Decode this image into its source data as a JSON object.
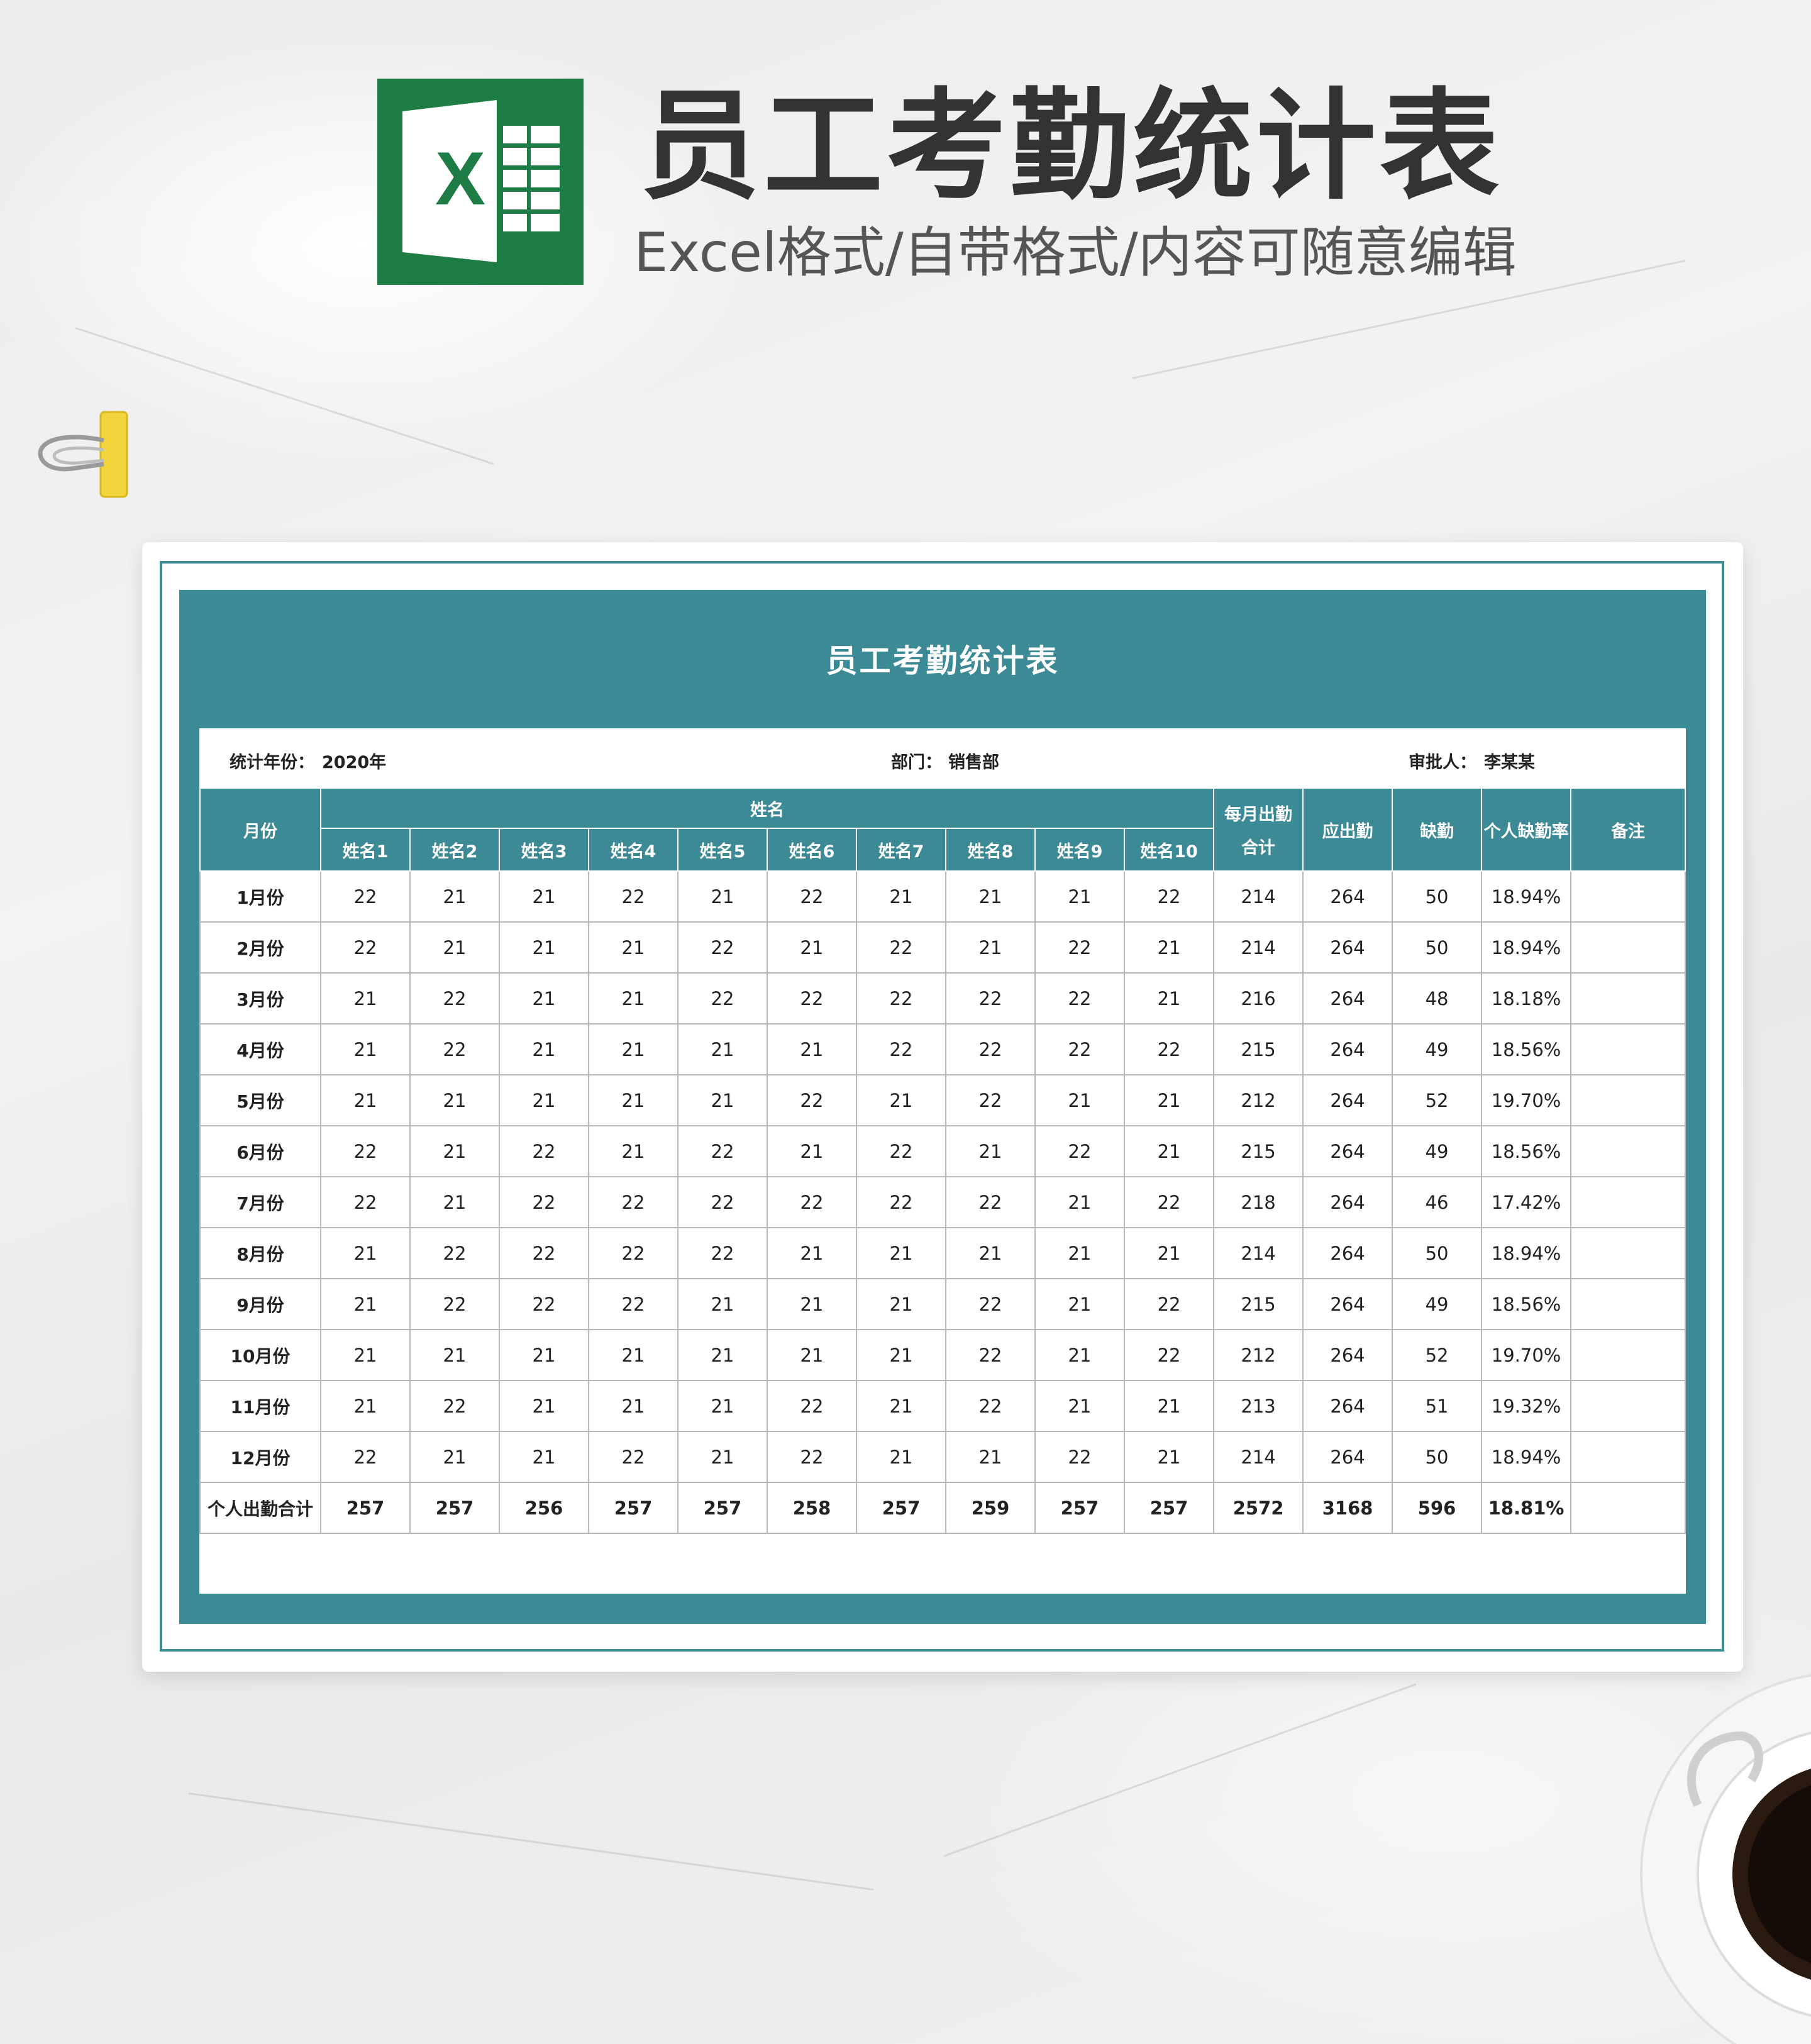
{
  "header": {
    "title": "员工考勤统计表",
    "subtitle": "Excel格式/自带格式/内容可随意编辑",
    "logo_letter": "X"
  },
  "colors": {
    "accent": "#3b8a96",
    "excel_green": "#1d7d45",
    "clip_yellow": "#f2d53c"
  },
  "sheet": {
    "title": "员工考勤统计表",
    "meta": {
      "year_label": "统计年份：",
      "year_value": "2020年",
      "dept_label": "部门：",
      "dept_value": "销售部",
      "approver_label": "审批人：",
      "approver_value": "李某某"
    },
    "headers": {
      "month": "月份",
      "name_group": "姓名",
      "names": [
        "姓名1",
        "姓名2",
        "姓名3",
        "姓名4",
        "姓名5",
        "姓名6",
        "姓名7",
        "姓名8",
        "姓名9",
        "姓名10"
      ],
      "monthly_total_line1": "每月出勤",
      "monthly_total_line2": "合计",
      "expected": "应出勤",
      "absent": "缺勤",
      "absence_rate": "个人缺勤率",
      "remark": "备注"
    },
    "rows": [
      {
        "month": "1月份",
        "v": [
          "22",
          "21",
          "21",
          "22",
          "21",
          "22",
          "21",
          "21",
          "21",
          "22"
        ],
        "total": "214",
        "expected": "264",
        "absent": "50",
        "rate": "18.94%",
        "remark": ""
      },
      {
        "month": "2月份",
        "v": [
          "22",
          "21",
          "21",
          "21",
          "22",
          "21",
          "22",
          "21",
          "22",
          "21"
        ],
        "total": "214",
        "expected": "264",
        "absent": "50",
        "rate": "18.94%",
        "remark": ""
      },
      {
        "month": "3月份",
        "v": [
          "21",
          "22",
          "21",
          "21",
          "22",
          "22",
          "22",
          "22",
          "22",
          "21"
        ],
        "total": "216",
        "expected": "264",
        "absent": "48",
        "rate": "18.18%",
        "remark": ""
      },
      {
        "month": "4月份",
        "v": [
          "21",
          "22",
          "21",
          "21",
          "21",
          "21",
          "22",
          "22",
          "22",
          "22"
        ],
        "total": "215",
        "expected": "264",
        "absent": "49",
        "rate": "18.56%",
        "remark": ""
      },
      {
        "month": "5月份",
        "v": [
          "21",
          "21",
          "21",
          "21",
          "21",
          "22",
          "21",
          "22",
          "21",
          "21"
        ],
        "total": "212",
        "expected": "264",
        "absent": "52",
        "rate": "19.70%",
        "remark": ""
      },
      {
        "month": "6月份",
        "v": [
          "22",
          "21",
          "22",
          "21",
          "22",
          "21",
          "22",
          "21",
          "22",
          "21"
        ],
        "total": "215",
        "expected": "264",
        "absent": "49",
        "rate": "18.56%",
        "remark": ""
      },
      {
        "month": "7月份",
        "v": [
          "22",
          "21",
          "22",
          "22",
          "22",
          "22",
          "22",
          "22",
          "21",
          "22"
        ],
        "total": "218",
        "expected": "264",
        "absent": "46",
        "rate": "17.42%",
        "remark": ""
      },
      {
        "month": "8月份",
        "v": [
          "21",
          "22",
          "22",
          "22",
          "22",
          "21",
          "21",
          "21",
          "21",
          "21"
        ],
        "total": "214",
        "expected": "264",
        "absent": "50",
        "rate": "18.94%",
        "remark": ""
      },
      {
        "month": "9月份",
        "v": [
          "21",
          "22",
          "22",
          "22",
          "21",
          "21",
          "21",
          "22",
          "21",
          "22"
        ],
        "total": "215",
        "expected": "264",
        "absent": "49",
        "rate": "18.56%",
        "remark": ""
      },
      {
        "month": "10月份",
        "v": [
          "21",
          "21",
          "21",
          "21",
          "21",
          "21",
          "21",
          "22",
          "21",
          "22"
        ],
        "total": "212",
        "expected": "264",
        "absent": "52",
        "rate": "19.70%",
        "remark": ""
      },
      {
        "month": "11月份",
        "v": [
          "21",
          "22",
          "21",
          "21",
          "21",
          "22",
          "21",
          "22",
          "21",
          "21"
        ],
        "total": "213",
        "expected": "264",
        "absent": "51",
        "rate": "19.32%",
        "remark": ""
      },
      {
        "month": "12月份",
        "v": [
          "22",
          "21",
          "21",
          "22",
          "21",
          "22",
          "21",
          "21",
          "22",
          "21"
        ],
        "total": "214",
        "expected": "264",
        "absent": "50",
        "rate": "18.94%",
        "remark": ""
      }
    ],
    "total_row": {
      "label": "个人出勤合计",
      "v": [
        "257",
        "257",
        "256",
        "257",
        "257",
        "258",
        "257",
        "259",
        "257",
        "257"
      ],
      "total": "2572",
      "expected": "3168",
      "absent": "596",
      "rate": "18.81%",
      "remark": ""
    }
  }
}
